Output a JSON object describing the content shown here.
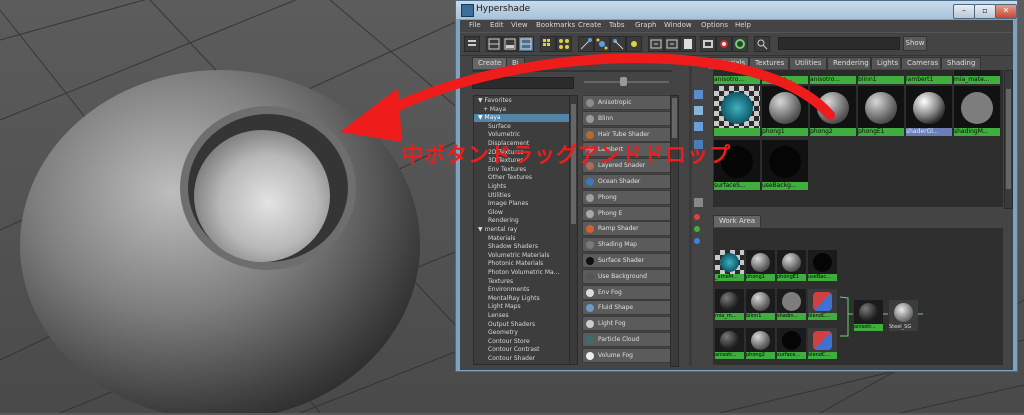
{
  "window": {
    "title": "Hypershade",
    "controls": [
      "–",
      "▫",
      "✕"
    ]
  },
  "menubar": [
    "File",
    "Edit",
    "View",
    "Bookmarks",
    "Create",
    "Tabs",
    "Graph",
    "Window",
    "Options",
    "Help"
  ],
  "toolbar": {
    "show_label": "Show"
  },
  "left_panel": {
    "tabs": [
      "Create",
      "Bi"
    ],
    "tree": [
      {
        "label": "Favorites",
        "indent": 0,
        "expander": "▼"
      },
      {
        "label": "+ Maya",
        "indent": 1
      },
      {
        "label": "Maya",
        "indent": 0,
        "expander": "▼",
        "selected": true
      },
      {
        "label": "Surface",
        "indent": 2
      },
      {
        "label": "Volumetric",
        "indent": 2
      },
      {
        "label": "Displacement",
        "indent": 2
      },
      {
        "label": "2D Textures",
        "indent": 2
      },
      {
        "label": "3D Textures",
        "indent": 2
      },
      {
        "label": "Env Textures",
        "indent": 2
      },
      {
        "label": "Other Textures",
        "indent": 2
      },
      {
        "label": "Lights",
        "indent": 2
      },
      {
        "label": "Utilities",
        "indent": 2
      },
      {
        "label": "Image Planes",
        "indent": 2
      },
      {
        "label": "Glow",
        "indent": 2
      },
      {
        "label": "Rendering",
        "indent": 2
      },
      {
        "label": "mental ray",
        "indent": 0,
        "expander": "▼"
      },
      {
        "label": "Materials",
        "indent": 2
      },
      {
        "label": "Shadow Shaders",
        "indent": 2
      },
      {
        "label": "Volumetric Materials",
        "indent": 2
      },
      {
        "label": "Photonic Materials",
        "indent": 2
      },
      {
        "label": "Photon Volumetric Ma...",
        "indent": 2
      },
      {
        "label": "Textures",
        "indent": 2
      },
      {
        "label": "Environments",
        "indent": 2
      },
      {
        "label": "MentalRay Lights",
        "indent": 2
      },
      {
        "label": "Light Maps",
        "indent": 2
      },
      {
        "label": "Lenses",
        "indent": 2
      },
      {
        "label": "Output Shaders",
        "indent": 2
      },
      {
        "label": "Geometry",
        "indent": 2
      },
      {
        "label": "Contour Store",
        "indent": 2
      },
      {
        "label": "Contour Contrast",
        "indent": 2
      },
      {
        "label": "Contour Shader",
        "indent": 2
      }
    ],
    "node_list": [
      {
        "label": "Anisotropic",
        "color": "#8c8c8c"
      },
      {
        "label": "Blinn",
        "color": "#9a9a9a"
      },
      {
        "label": "Hair Tube Shader",
        "color": "#b86a2e"
      },
      {
        "label": "Lambert",
        "color": "#8a8a8a"
      },
      {
        "label": "Layered Shader",
        "color": "#b06a5a"
      },
      {
        "label": "Ocean Shader",
        "color": "#3c78b8"
      },
      {
        "label": "Phong",
        "color": "#a0a0a0"
      },
      {
        "label": "Phong E",
        "color": "#a8a8a8"
      },
      {
        "label": "Ramp Shader",
        "color": "#d06030"
      },
      {
        "label": "Shading Map",
        "color": "#7a7a7a"
      },
      {
        "label": "Surface Shader",
        "color": "#101010"
      },
      {
        "label": "Use Background",
        "color": "#555555"
      },
      {
        "label": "Env Fog",
        "color": "#dddddd"
      },
      {
        "label": "Fluid Shape",
        "color": "#6a9ac8"
      },
      {
        "label": "Light Fog",
        "color": "#cccccc"
      },
      {
        "label": "Particle Cloud",
        "color": "#3a6e6e"
      },
      {
        "label": "Volume Fog",
        "color": "#eeeeee"
      }
    ]
  },
  "right_panel": {
    "tabs": [
      "Materials",
      "Textures",
      "Utilities",
      "Rendering",
      "Lights",
      "Cameras",
      "Shading"
    ],
    "swatches_top_row": [
      "anisotro...",
      "anisotro...",
      "anisotro...",
      "blinn1",
      "lambert1",
      "mia_mate..."
    ],
    "swatches_row2": [
      {
        "label": "",
        "kind": "checker"
      },
      {
        "label": "phong1",
        "kind": "grey"
      },
      {
        "label": "phong2",
        "kind": "grey"
      },
      {
        "label": "phongE1",
        "kind": "grey"
      },
      {
        "label": "shaderGl...",
        "kind": "glow",
        "selected": true
      },
      {
        "label": "shadingM...",
        "kind": "flat"
      }
    ],
    "swatches_row3": [
      {
        "label": "surfaceS...",
        "kind": "black"
      },
      {
        "label": "useBackg...",
        "kind": "black"
      }
    ],
    "work_area_tab": "Work Area",
    "work_nodes": [
      {
        "label": "_atheM...",
        "kind": "checker",
        "col": 0,
        "row": 0
      },
      {
        "label": "phong1",
        "kind": "grey",
        "col": 1,
        "row": 0
      },
      {
        "label": "phongE1",
        "kind": "grey",
        "col": 2,
        "row": 0
      },
      {
        "label": "useBac...",
        "kind": "black",
        "col": 3,
        "row": 0
      },
      {
        "label": "mia_m...",
        "kind": "dark",
        "col": 0,
        "row": 1
      },
      {
        "label": "blinn1",
        "kind": "grey",
        "col": 1,
        "row": 1
      },
      {
        "label": "shadin...",
        "kind": "flat",
        "col": 2,
        "row": 1
      },
      {
        "label": "blendC...",
        "kind": "blend",
        "col": 3,
        "row": 1
      },
      {
        "label": "anisotr...",
        "kind": "dark",
        "col": 0,
        "row": 2
      },
      {
        "label": "phong2",
        "kind": "grey",
        "col": 1,
        "row": 2
      },
      {
        "label": "surface...",
        "kind": "black",
        "col": 2,
        "row": 2
      },
      {
        "label": "blendC...",
        "kind": "blend",
        "col": 3,
        "row": 2
      }
    ],
    "output_nodes": [
      {
        "label": "anisotr...",
        "kind": "dark"
      },
      {
        "label": "Steel_SG",
        "kind": "sg"
      }
    ]
  },
  "annotation": {
    "text": "中ボタンドラッグアンドドロップ",
    "color": "#ef1c1c"
  }
}
